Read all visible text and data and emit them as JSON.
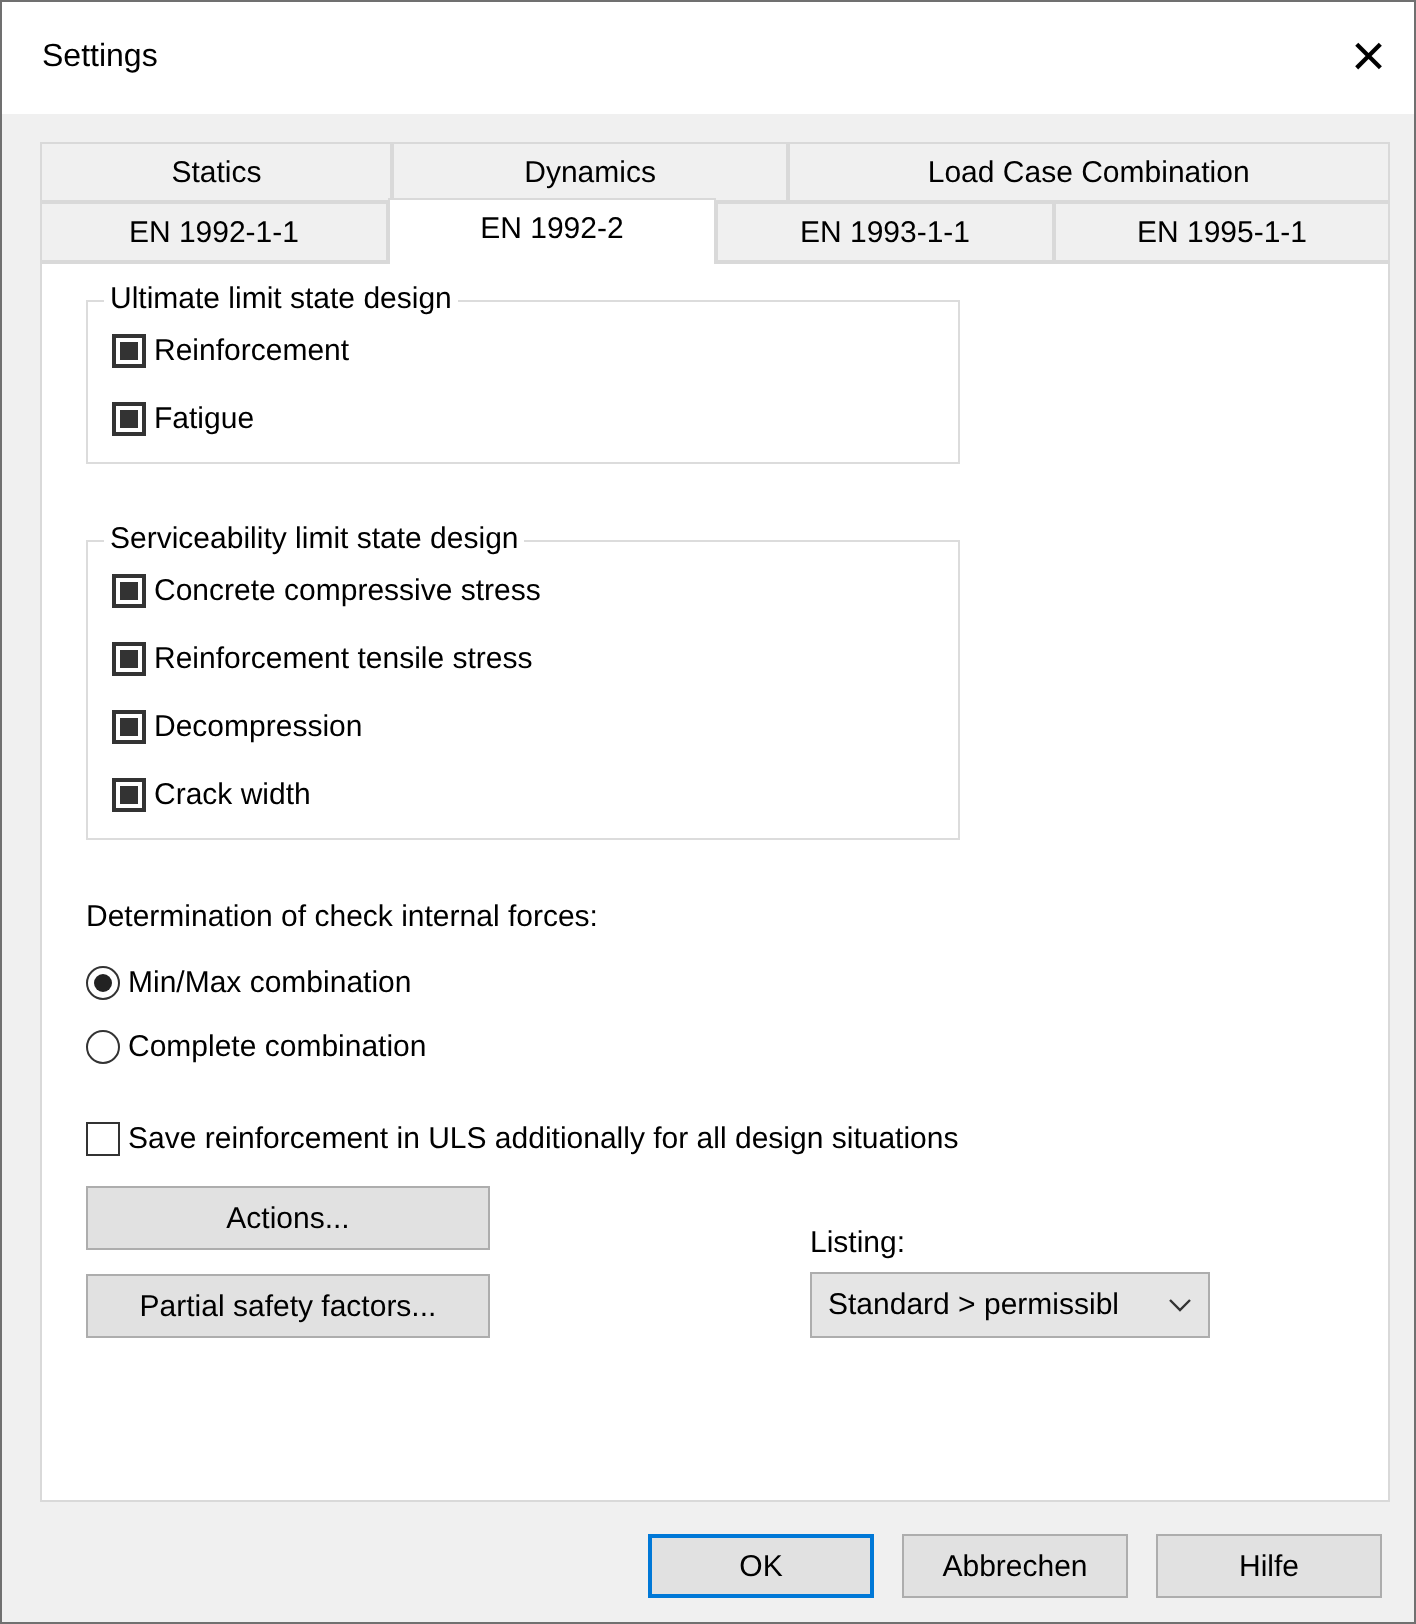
{
  "window": {
    "title": "Settings",
    "close": "×"
  },
  "tab_rows": [
    [
      {
        "label": "Statics",
        "selected": false
      },
      {
        "label": "Dynamics",
        "selected": false
      },
      {
        "label": "Load Case Combination",
        "selected": false
      }
    ],
    [
      {
        "label": "EN 1992-1-1",
        "selected": false
      },
      {
        "label": "EN 1992-2",
        "selected": true
      },
      {
        "label": "EN 1993-1-1",
        "selected": false
      },
      {
        "label": "EN 1995-1-1",
        "selected": false
      }
    ]
  ],
  "groups": [
    {
      "title": "Ultimate limit state design",
      "options": [
        {
          "label": "Reinforcement",
          "checked": true
        },
        {
          "label": "Fatigue",
          "checked": true
        }
      ]
    },
    {
      "title": "Serviceability limit state design",
      "options": [
        {
          "label": "Concrete compressive stress",
          "checked": true
        },
        {
          "label": "Reinforcement tensile stress",
          "checked": true
        },
        {
          "label": "Decompression",
          "checked": true
        },
        {
          "label": "Crack width",
          "checked": true
        }
      ]
    }
  ],
  "forces": {
    "label": "Determination of check internal forces:",
    "options": [
      {
        "label": "Min/Max combination",
        "selected": true
      },
      {
        "label": "Complete combination",
        "selected": false
      }
    ]
  },
  "save_option": {
    "label": "Save reinforcement in ULS additionally for all design situations",
    "checked": false
  },
  "buttons": [
    "Actions...",
    "Partial safety factors..."
  ],
  "listing": {
    "label": "Listing:",
    "value": "Standard > permissibl"
  },
  "footer_buttons": [
    {
      "label": "OK",
      "focused": true
    },
    {
      "label": "Abbrechen",
      "focused": false
    },
    {
      "label": "Hilfe",
      "focused": false
    }
  ]
}
